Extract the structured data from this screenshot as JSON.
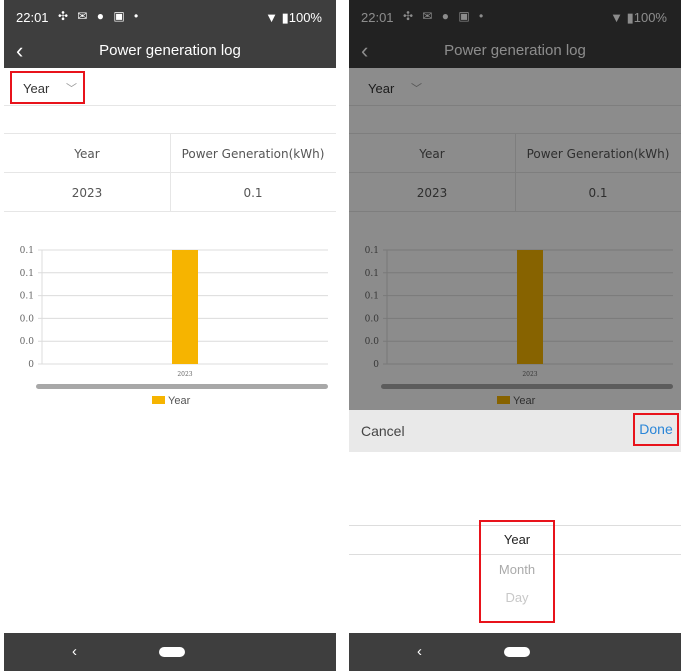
{
  "status_bar": {
    "time": "22:01",
    "icons": "✣ ✉ ● ▣ •",
    "battery": "▼ ▮100%"
  },
  "app_bar": {
    "back_icon": "‹",
    "title": "Power generation log"
  },
  "filter": {
    "selected": "Year",
    "chevron": "﹀"
  },
  "table": {
    "headers": [
      "Year",
      "Power Generation(kWh)"
    ],
    "rows": [
      [
        "2023",
        "0.1"
      ]
    ]
  },
  "chart_data": {
    "type": "bar",
    "categories": [
      "2023"
    ],
    "series": [
      {
        "name": "Year",
        "values": [
          0.1
        ],
        "color": "#f6b400"
      }
    ],
    "y_tick_labels": [
      "0.1",
      "0.1",
      "0.1",
      "0.0",
      "0.0",
      "0"
    ],
    "ylim": [
      0,
      0.1
    ],
    "grid": true,
    "legend_position": "bottom"
  },
  "bottom_sheet": {
    "cancel_label": "Cancel",
    "done_label": "Done"
  },
  "picker": {
    "options": [
      "Year",
      "Month",
      "Day"
    ],
    "selected": "Year"
  },
  "nav_bar": {
    "back_glyph": "‹"
  },
  "colors": {
    "bar": "#f6b400",
    "highlight": "#e8131b",
    "done": "#2a86d8",
    "bar_bg": "#3e3e3e"
  }
}
